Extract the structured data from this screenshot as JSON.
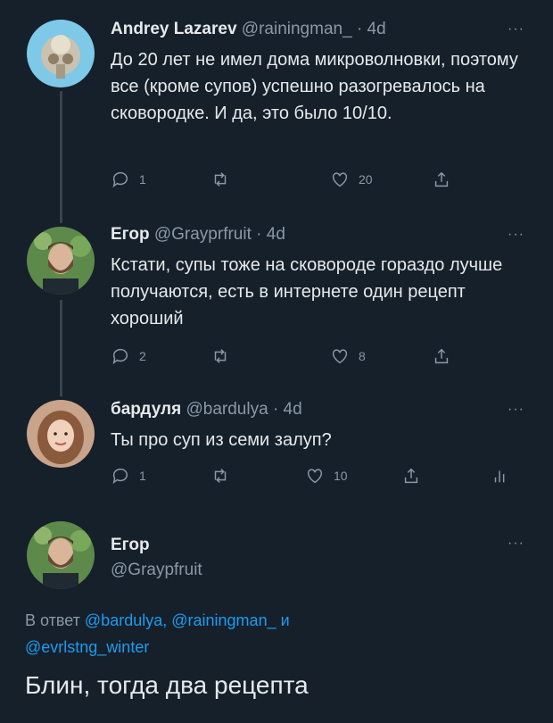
{
  "tweets": [
    {
      "name": "Andrey Lazarev",
      "handle": "@rainingman_",
      "time": "4d",
      "text": "До 20 лет не имел дома микроволновки, поэтому все (кроме супов) успешно разогревалось на сковородке. И да, это было 10/10.",
      "replies": "1",
      "retweets": "",
      "likes": "20",
      "avatar": "ornament-avatar"
    },
    {
      "name": "Егор",
      "handle": "@Grayprfruit",
      "time": "4d",
      "text": "Кстати, супы тоже на сковороде гораздо лучше получаются, есть в интернете один рецепт хороший",
      "replies": "2",
      "retweets": "",
      "likes": "8",
      "avatar": "bearded-man-avatar"
    },
    {
      "name": "бардуля",
      "handle": "@bardulya",
      "time": "4d",
      "text": "Ты про суп из семи залуп?",
      "replies": "1",
      "retweets": "",
      "likes": "10",
      "avatar": "woman-avatar"
    }
  ],
  "main_tweet": {
    "name": "Егор",
    "handle": "@Graypfruit",
    "reply_prefix": "В ответ",
    "mention_1": "@bardulya,",
    "mention_2": "@rainingman_",
    "conjunction": "и",
    "mention_3": "@evrlstng_winter",
    "text": "Блин, тогда два рецепта"
  },
  "ui": {
    "more_label": "···",
    "dot": "·"
  },
  "colors": {
    "background": "#15202b",
    "accent": "#1d9bf0",
    "muted": "#8b98a5"
  }
}
